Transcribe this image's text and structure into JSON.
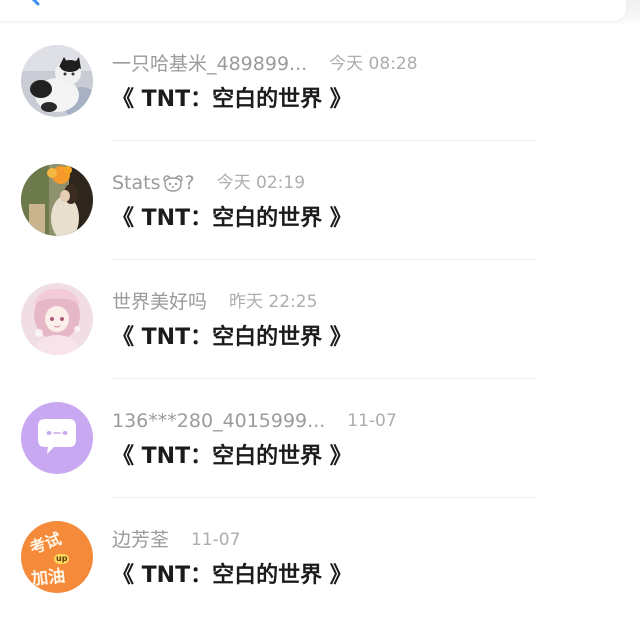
{
  "top_bar": {
    "icon": "back-chevron-icon"
  },
  "colors": {
    "accent": "#3a8ef6",
    "username": "#9b9b9b",
    "time": "#adadad",
    "message": "#1c1c1c",
    "avatar_purple": "#c9a8f2",
    "avatar_orange": "#f48a3a"
  },
  "comments": [
    {
      "username": "一只哈基米_489899...",
      "time": "今天 08:28",
      "message": "《 TNT：空白的世界 》",
      "avatar": {
        "kind": "photo-cat"
      }
    },
    {
      "username": "Stats",
      "username_icon": "bear-face-icon",
      "username_suffix": "?",
      "time": "今天 02:19",
      "message": "《 TNT：空白的世界 》",
      "avatar": {
        "kind": "photo-person-flowers"
      }
    },
    {
      "username": "世界美好吗",
      "time": "昨天 22:25",
      "message": "《 TNT：空白的世界 》",
      "avatar": {
        "kind": "illustration-anime-girl"
      }
    },
    {
      "username": "136***280_4015999...",
      "time": "11-07",
      "message": "《 TNT：空白的世界 》",
      "avatar": {
        "kind": "default-chat-bubble",
        "icon": "chat-bubble-icon"
      }
    },
    {
      "username": "边芳荃",
      "time": "11-07",
      "message": "《 TNT：空白的世界 》",
      "avatar": {
        "kind": "text-image",
        "text_top": "考试",
        "text_bottom": "加油",
        "text_badge": "up"
      }
    }
  ]
}
